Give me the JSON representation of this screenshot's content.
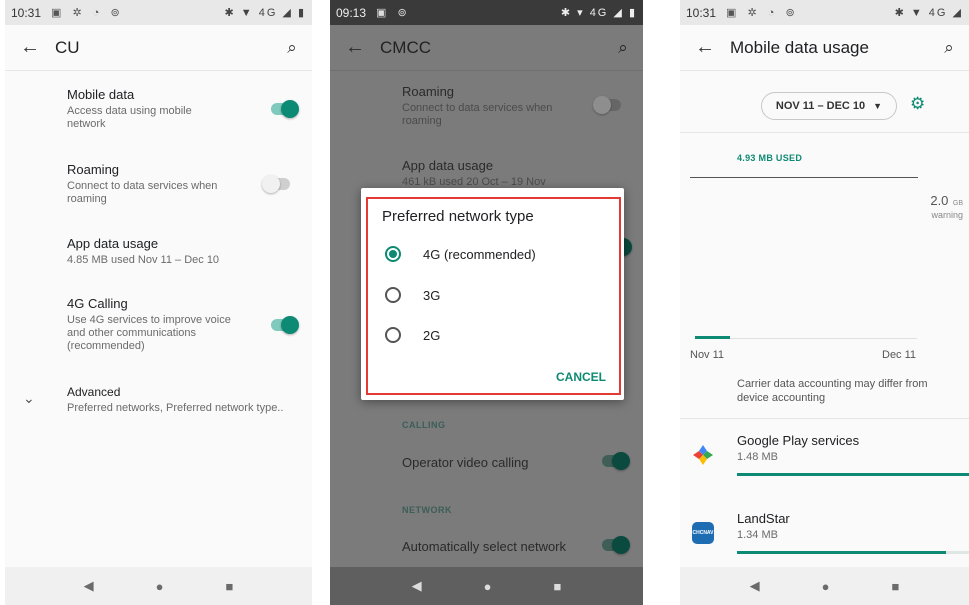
{
  "colors": {
    "accent": "#0d8a73",
    "highlight_border": "#e53935",
    "dim_overlay": "#7b7b7b"
  },
  "screen1": {
    "time": "10:31",
    "status_icons": "▣ ✲ ◔ ⊚",
    "status_right": "✱ ▼ 4G ◢ ▮",
    "title": "CU",
    "mobile_data": {
      "title": "Mobile data",
      "summary": "Access data using mobile network",
      "enabled": true
    },
    "roaming": {
      "title": "Roaming",
      "summary": "Connect to data services when roaming",
      "enabled": false
    },
    "app_data_usage": {
      "title": "App data usage",
      "summary": "4.85 MB used Nov 11 – Dec 10"
    },
    "calling_4g": {
      "title": "4G Calling",
      "summary": "Use 4G services to improve voice and other communications (recommended)",
      "enabled": true
    },
    "advanced": {
      "title": "Advanced",
      "summary": "Preferred networks, Preferred network type.."
    }
  },
  "screen2": {
    "time": "09:13",
    "status_icons": "▣ ⊚",
    "status_right": "✱ ▾ 4G ◢ ▮",
    "title": "CMCC",
    "roaming": {
      "title": "Roaming",
      "summary": "Connect to data services when roaming",
      "enabled": false
    },
    "app_data_usage": {
      "title": "App data usage",
      "summary": "461 kB used 20 Oct – 19 Nov"
    },
    "calling_header": "CALLING",
    "operator_video": {
      "title": "Operator video calling",
      "enabled": true
    },
    "network_header": "NETWORK",
    "auto_network": {
      "title": "Automatically select network",
      "enabled": true
    },
    "dialog": {
      "title": "Preferred network type",
      "options": [
        "4G (recommended)",
        "3G",
        "2G"
      ],
      "selected_index": 0,
      "cancel_label": "CANCEL"
    }
  },
  "screen3": {
    "time": "10:31",
    "status_icons": "▣ ✲ ◔ ⊚",
    "status_right": "✱ ▼ 4G ◢",
    "title": "Mobile data usage",
    "date_range": "NOV 11 – DEC 10",
    "used_label": "4.93 MB USED",
    "warning_value": "2.0",
    "warning_unit": "GB",
    "warning_label": "warning",
    "axis_start": "Nov 11",
    "axis_end": "Dec 11",
    "disclaimer": "Carrier data accounting may differ from device accounting",
    "apps": [
      {
        "name": "Google Play services",
        "size": "1.48 MB",
        "usage_fraction": 1.0
      },
      {
        "name": "LandStar",
        "size": "1.34 MB",
        "usage_fraction": 0.9
      }
    ],
    "landstar_icon_text": "CHCNAV"
  }
}
